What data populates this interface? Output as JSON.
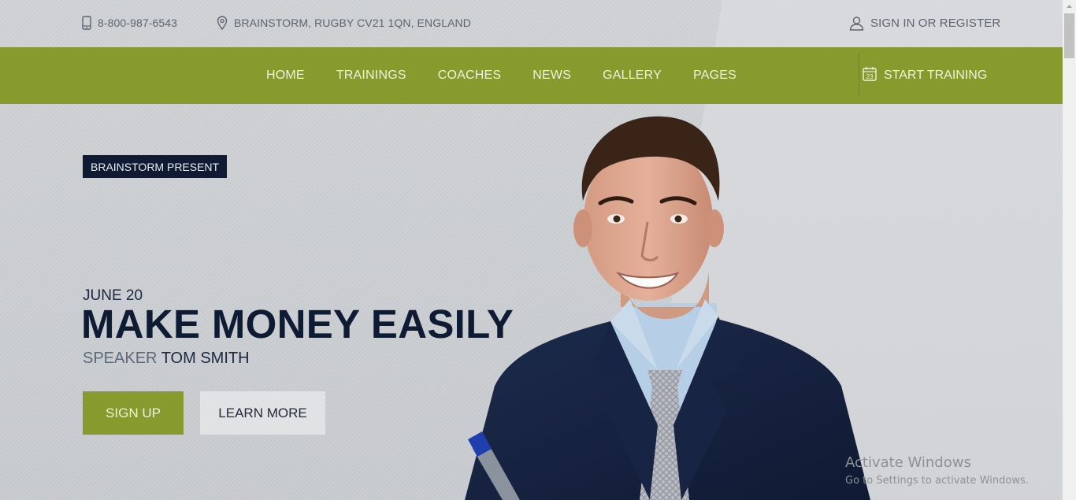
{
  "topbar": {
    "phone": "8-800-987-6543",
    "address": "BRAINSTORM, RUGBY CV21 1QN, ENGLAND",
    "signin": "SIGN IN OR REGISTER"
  },
  "nav": {
    "items": [
      {
        "label": "HOME"
      },
      {
        "label": "TRAININGS"
      },
      {
        "label": "COACHES"
      },
      {
        "label": "NEWS"
      },
      {
        "label": "GALLERY"
      },
      {
        "label": "PAGES"
      }
    ],
    "cta": {
      "label": "START TRAINING",
      "icon_day": "23"
    }
  },
  "hero": {
    "badge": "BRAINSTORM PRESENT",
    "date": "JUNE 20",
    "headline": "MAKE MONEY EASILY",
    "speaker_label": "SPEAKER",
    "speaker_name": "TOM SMITH",
    "signup_label": "SIGN UP",
    "learn_more_label": "LEARN MORE"
  },
  "watermark": {
    "title": "Activate Windows",
    "subtitle": "Go to Settings to activate Windows."
  },
  "colors": {
    "accent": "#879a2d",
    "navy": "#0e1b33",
    "background": "#cfd2d5"
  }
}
